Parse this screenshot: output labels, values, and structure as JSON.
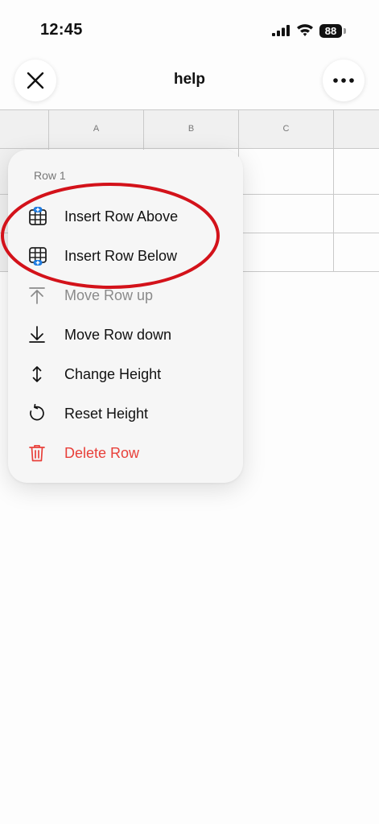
{
  "status_bar": {
    "time": "12:45",
    "battery": "88"
  },
  "header": {
    "title": "help"
  },
  "grid": {
    "columns": [
      "A",
      "B",
      "C"
    ]
  },
  "menu": {
    "title": "Row 1",
    "items": [
      {
        "label": "Insert Row Above",
        "icon": "insert-row-above-icon",
        "state": "enabled"
      },
      {
        "label": "Insert Row Below",
        "icon": "insert-row-below-icon",
        "state": "enabled"
      },
      {
        "label": "Move Row up",
        "icon": "arrow-up-bar-icon",
        "state": "disabled"
      },
      {
        "label": "Move Row down",
        "icon": "arrow-down-bar-icon",
        "state": "enabled"
      },
      {
        "label": "Change Height",
        "icon": "vertical-resize-icon",
        "state": "enabled"
      },
      {
        "label": "Reset Height",
        "icon": "reset-arrow-icon",
        "state": "enabled"
      },
      {
        "label": "Delete Row",
        "icon": "trash-icon",
        "state": "destructive"
      }
    ]
  },
  "colors": {
    "annotation": "#d3121a",
    "danger": "#e8403a",
    "accent": "#1e7be0"
  }
}
